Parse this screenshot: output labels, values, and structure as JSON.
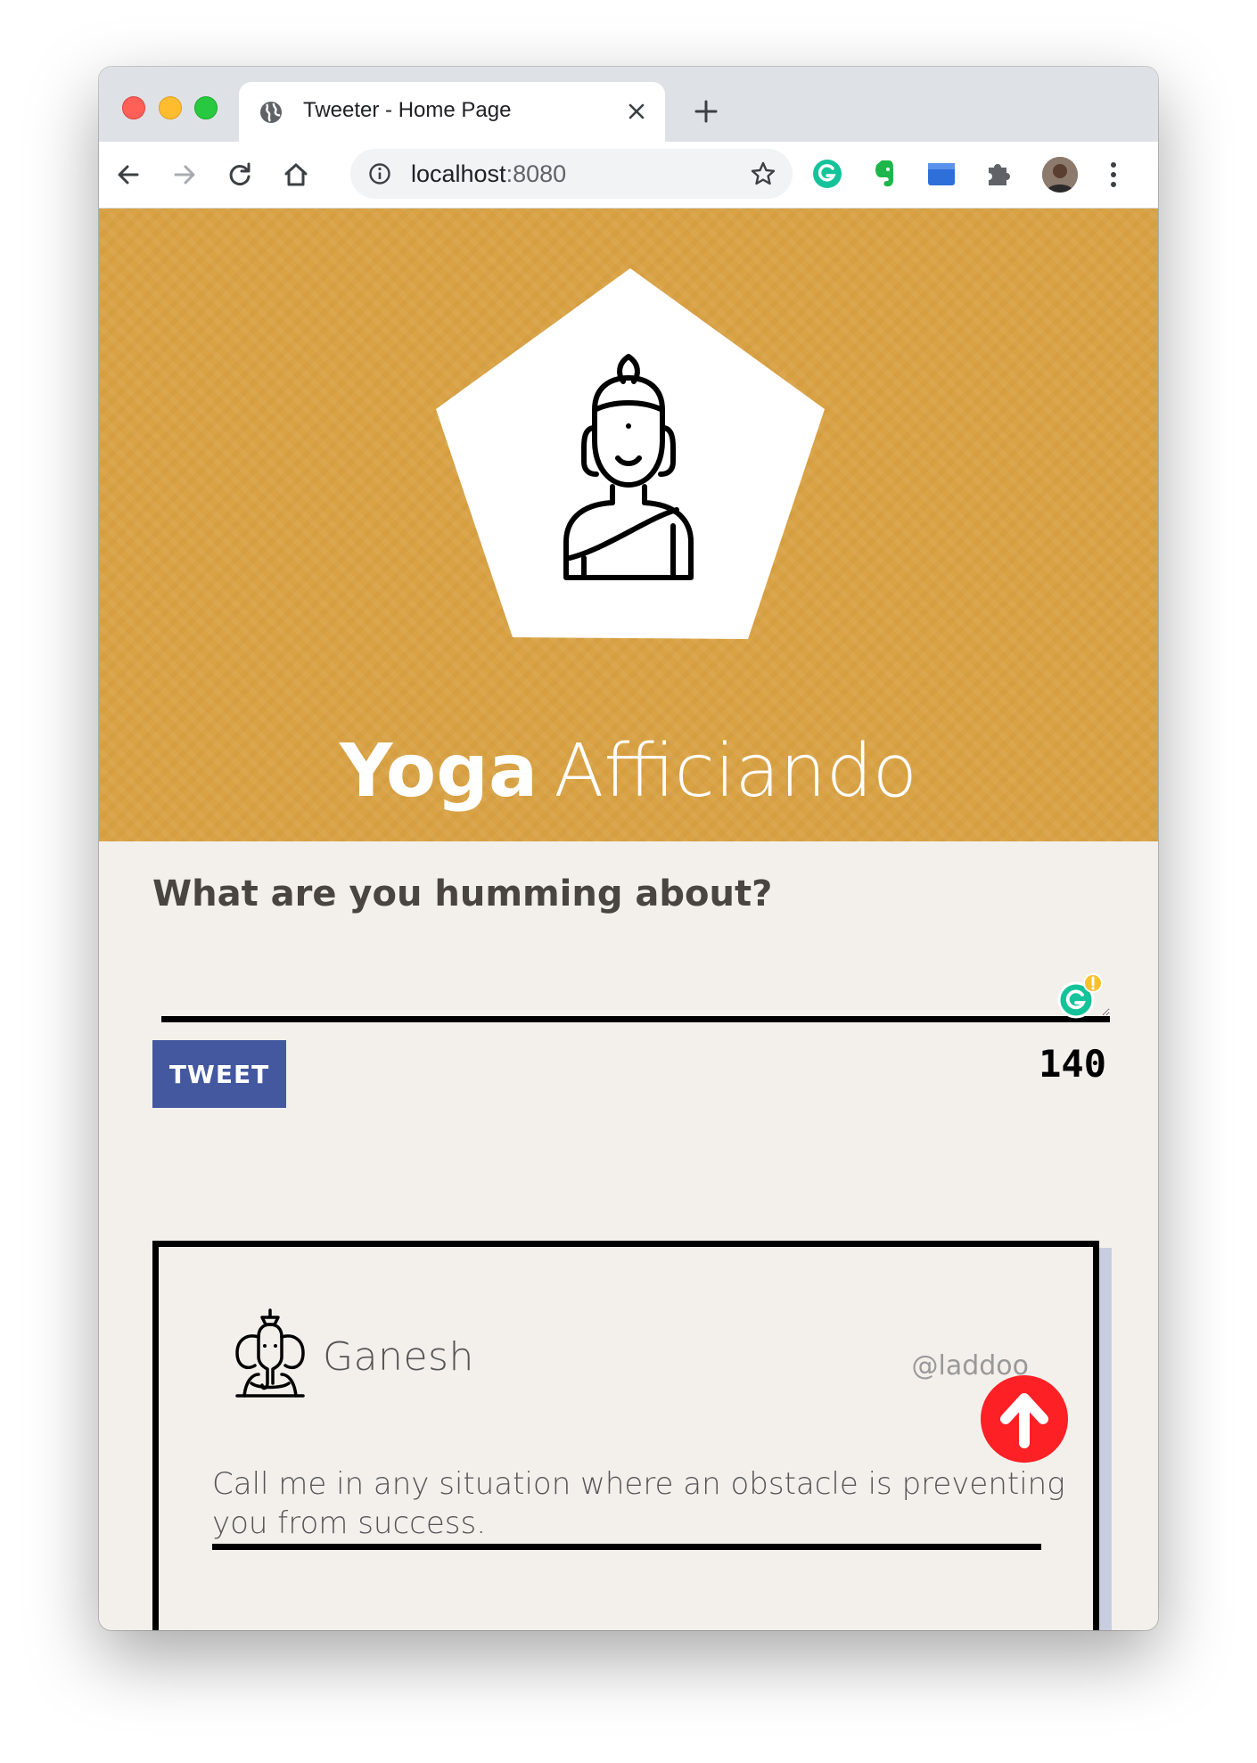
{
  "browser": {
    "tab_title": "Tweeter - Home Page",
    "url_host": "localhost",
    "url_port": ":8080",
    "icons": [
      "globe-icon",
      "close-icon",
      "plus-icon",
      "back-icon",
      "forward-icon",
      "reload-icon",
      "home-icon",
      "info-icon",
      "star-icon",
      "grammarly-icon",
      "evernote-icon",
      "extension-icon",
      "puzzle-icon",
      "avatar",
      "kebab-menu-icon"
    ]
  },
  "header": {
    "brand_bold": "Yoga",
    "brand_light": "Afficiando",
    "logo_icon": "buddha-icon",
    "background_color": "#d9a244"
  },
  "compose": {
    "heading": "What are you humming about?",
    "input_value": "",
    "tweet_button_label": "TWEET",
    "counter": "140",
    "button_color": "#44589f"
  },
  "tweets": [
    {
      "name": "Ganesh",
      "handle": "@laddoofever",
      "handle_visible": "@laddoo",
      "text": "Call me in any situation where an obstacle is preventing you from success.",
      "avatar_icon": "ganesh-icon"
    }
  ],
  "scroll_top": {
    "icon": "arrow-up-icon",
    "color": "#fd2025"
  }
}
